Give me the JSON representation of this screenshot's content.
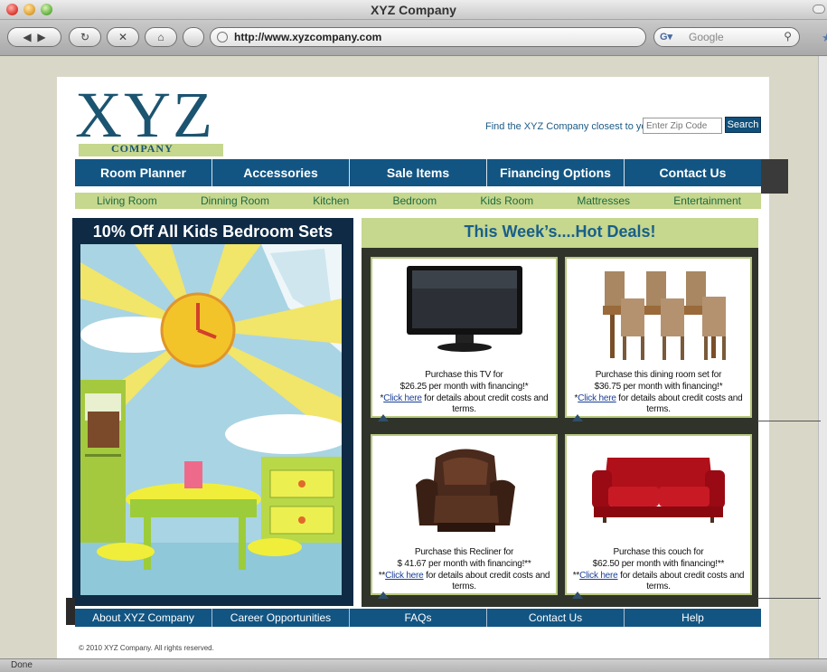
{
  "browser": {
    "window_title": "XYZ Company",
    "url": "http://www.xyzcompany.com",
    "search_placeholder": "Google",
    "status": "Done"
  },
  "header": {
    "logo_letters": "XYZ",
    "logo_sub": "COMPANY",
    "zip_label": "Find the XYZ Company closest to you:",
    "zip_placeholder": "Enter Zip Code",
    "search_button": "Search"
  },
  "main_nav": [
    "Room Planner",
    "Accessories",
    "Sale Items",
    "Financing Options",
    "Contact Us"
  ],
  "sub_nav": [
    "Living Room",
    "Dinning Room",
    "Kitchen",
    "Bedroom",
    "Kids Room",
    "Mattresses",
    "Entertainment"
  ],
  "promo": {
    "title": "10% Off All Kids Bedroom Sets"
  },
  "deals": {
    "title": "This Week’s....Hot Deals!",
    "items": [
      {
        "line1": "Purchase this TV for",
        "line2": "$26.25  per month with financing!*",
        "prefix": "*",
        "link": "Click here",
        "suffix": " for details about credit costs and terms."
      },
      {
        "line1": "Purchase this dining room  set for",
        "line2": "$36.75 per month with financing!*",
        "prefix": "*",
        "link": "Click here",
        "suffix": " for details about credit costs and terms."
      },
      {
        "line1": "Purchase this Recliner for",
        "line2": "$ 41.67 per month with financing!**",
        "prefix": "**",
        "link": "Click here",
        "suffix": " for details about credit costs and terms."
      },
      {
        "line1": "Purchase this couch for",
        "line2": "$62.50 per month with financing!**",
        "prefix": "**",
        "link": "Click here",
        "suffix": " for details about credit costs and terms."
      }
    ]
  },
  "footer_nav": [
    "About XYZ Company",
    "Career Opportunities",
    "FAQs",
    "Contact Us",
    "Help"
  ],
  "copyright": "© 2010 XYZ Company. All rights reserved.",
  "colors": {
    "nav_blue": "#125583",
    "accent_green": "#c6d78e",
    "deals_bg": "#30332a",
    "promo_bg": "#0f2a45"
  }
}
